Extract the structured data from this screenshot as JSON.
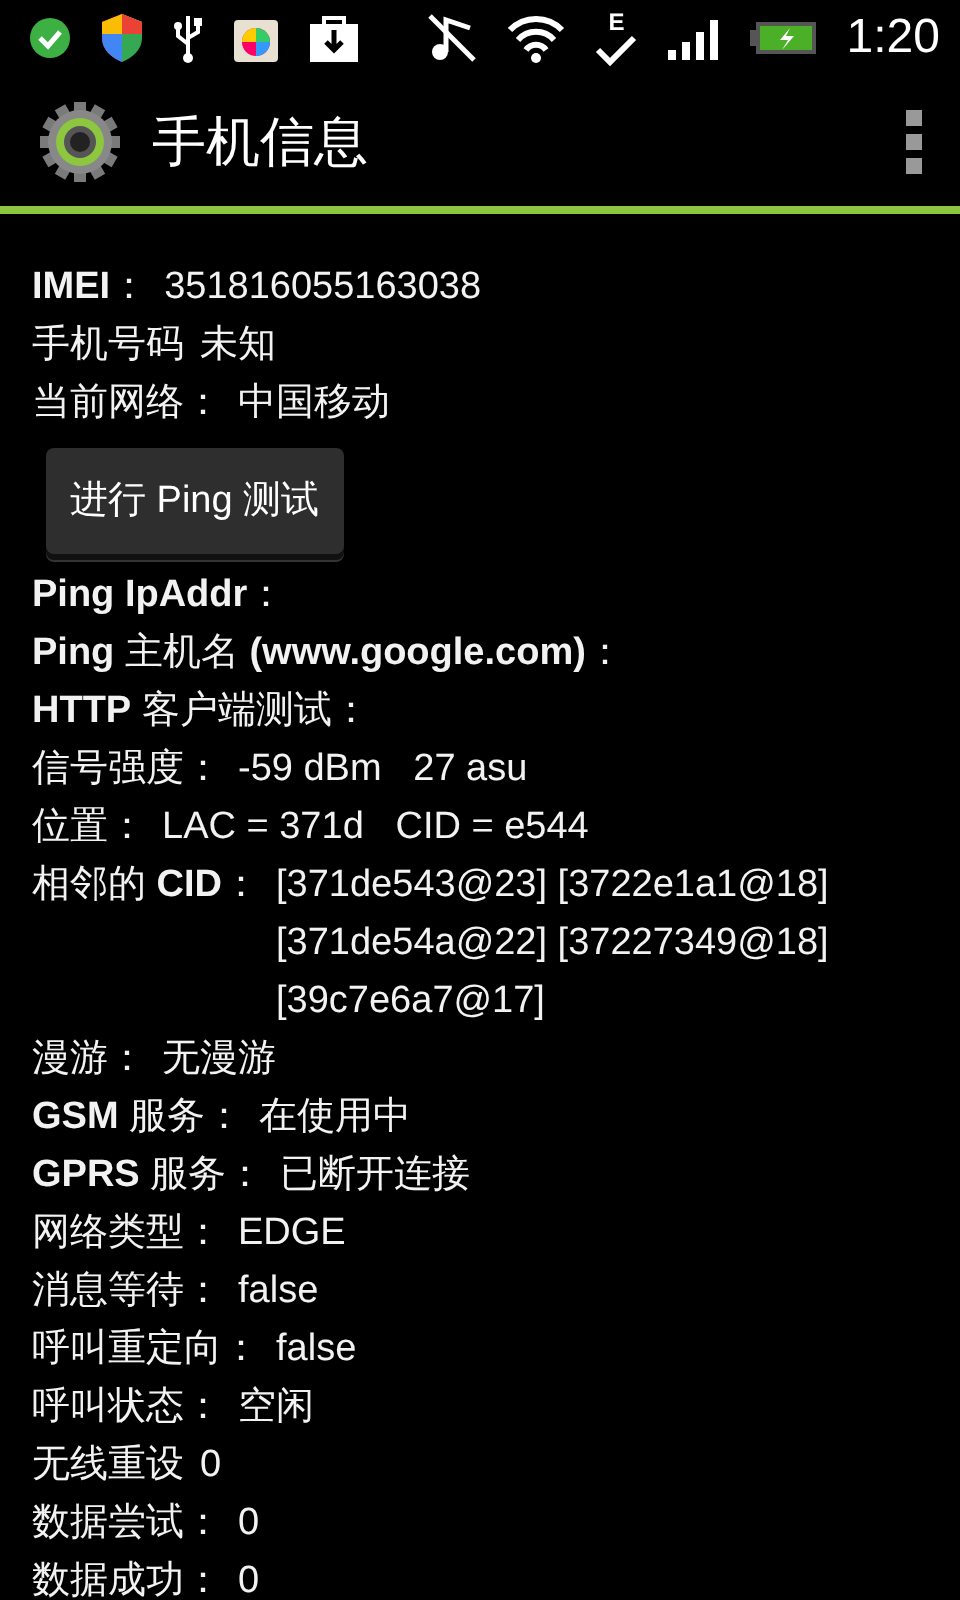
{
  "status_bar": {
    "network_type": "E",
    "time": "1:20"
  },
  "action_bar": {
    "title": "手机信息"
  },
  "items": [
    {
      "kind": "row",
      "label": "**IMEI**：",
      "value": "351816055163038"
    },
    {
      "kind": "row",
      "label": "手机号码",
      "value": "未知"
    },
    {
      "kind": "row",
      "label": "当前网络：",
      "value": "中国移动"
    },
    {
      "kind": "button",
      "label": "进行 Ping 测试"
    },
    {
      "kind": "row",
      "label": "**Ping IpAddr**："
    },
    {
      "kind": "row",
      "label": "**Ping** 主机名 **(www.google.com)**："
    },
    {
      "kind": "row",
      "label": "**HTTP** 客户端测试："
    },
    {
      "kind": "row",
      "label": "信号强度：",
      "value": "-59 dBm   27 asu"
    },
    {
      "kind": "row",
      "label": "位置：",
      "value": "LAC = 371d   CID = e544"
    },
    {
      "kind": "row",
      "label": "相邻的 **CID**：",
      "value": "[371de543@23] [3722e1a1@18] [371de54a@22] [37227349@18] [39c7e6a7@17]"
    },
    {
      "kind": "row",
      "label": "漫游：",
      "value": "无漫游"
    },
    {
      "kind": "row",
      "label": "**GSM** 服务：",
      "value": "在使用中"
    },
    {
      "kind": "row",
      "label": "**GPRS** 服务：",
      "value": "已断开连接"
    },
    {
      "kind": "row",
      "label": "网络类型：",
      "value": "EDGE"
    },
    {
      "kind": "row",
      "label": "消息等待：",
      "value": "false"
    },
    {
      "kind": "row",
      "label": "呼叫重定向：",
      "value": "false"
    },
    {
      "kind": "row",
      "label": "呼叫状态：",
      "value": "空闲"
    },
    {
      "kind": "row",
      "label": "无线重设",
      "value": "0"
    },
    {
      "kind": "row",
      "label": "数据尝试：",
      "value": "0"
    },
    {
      "kind": "row",
      "label": "数据成功：",
      "value": "0"
    }
  ]
}
